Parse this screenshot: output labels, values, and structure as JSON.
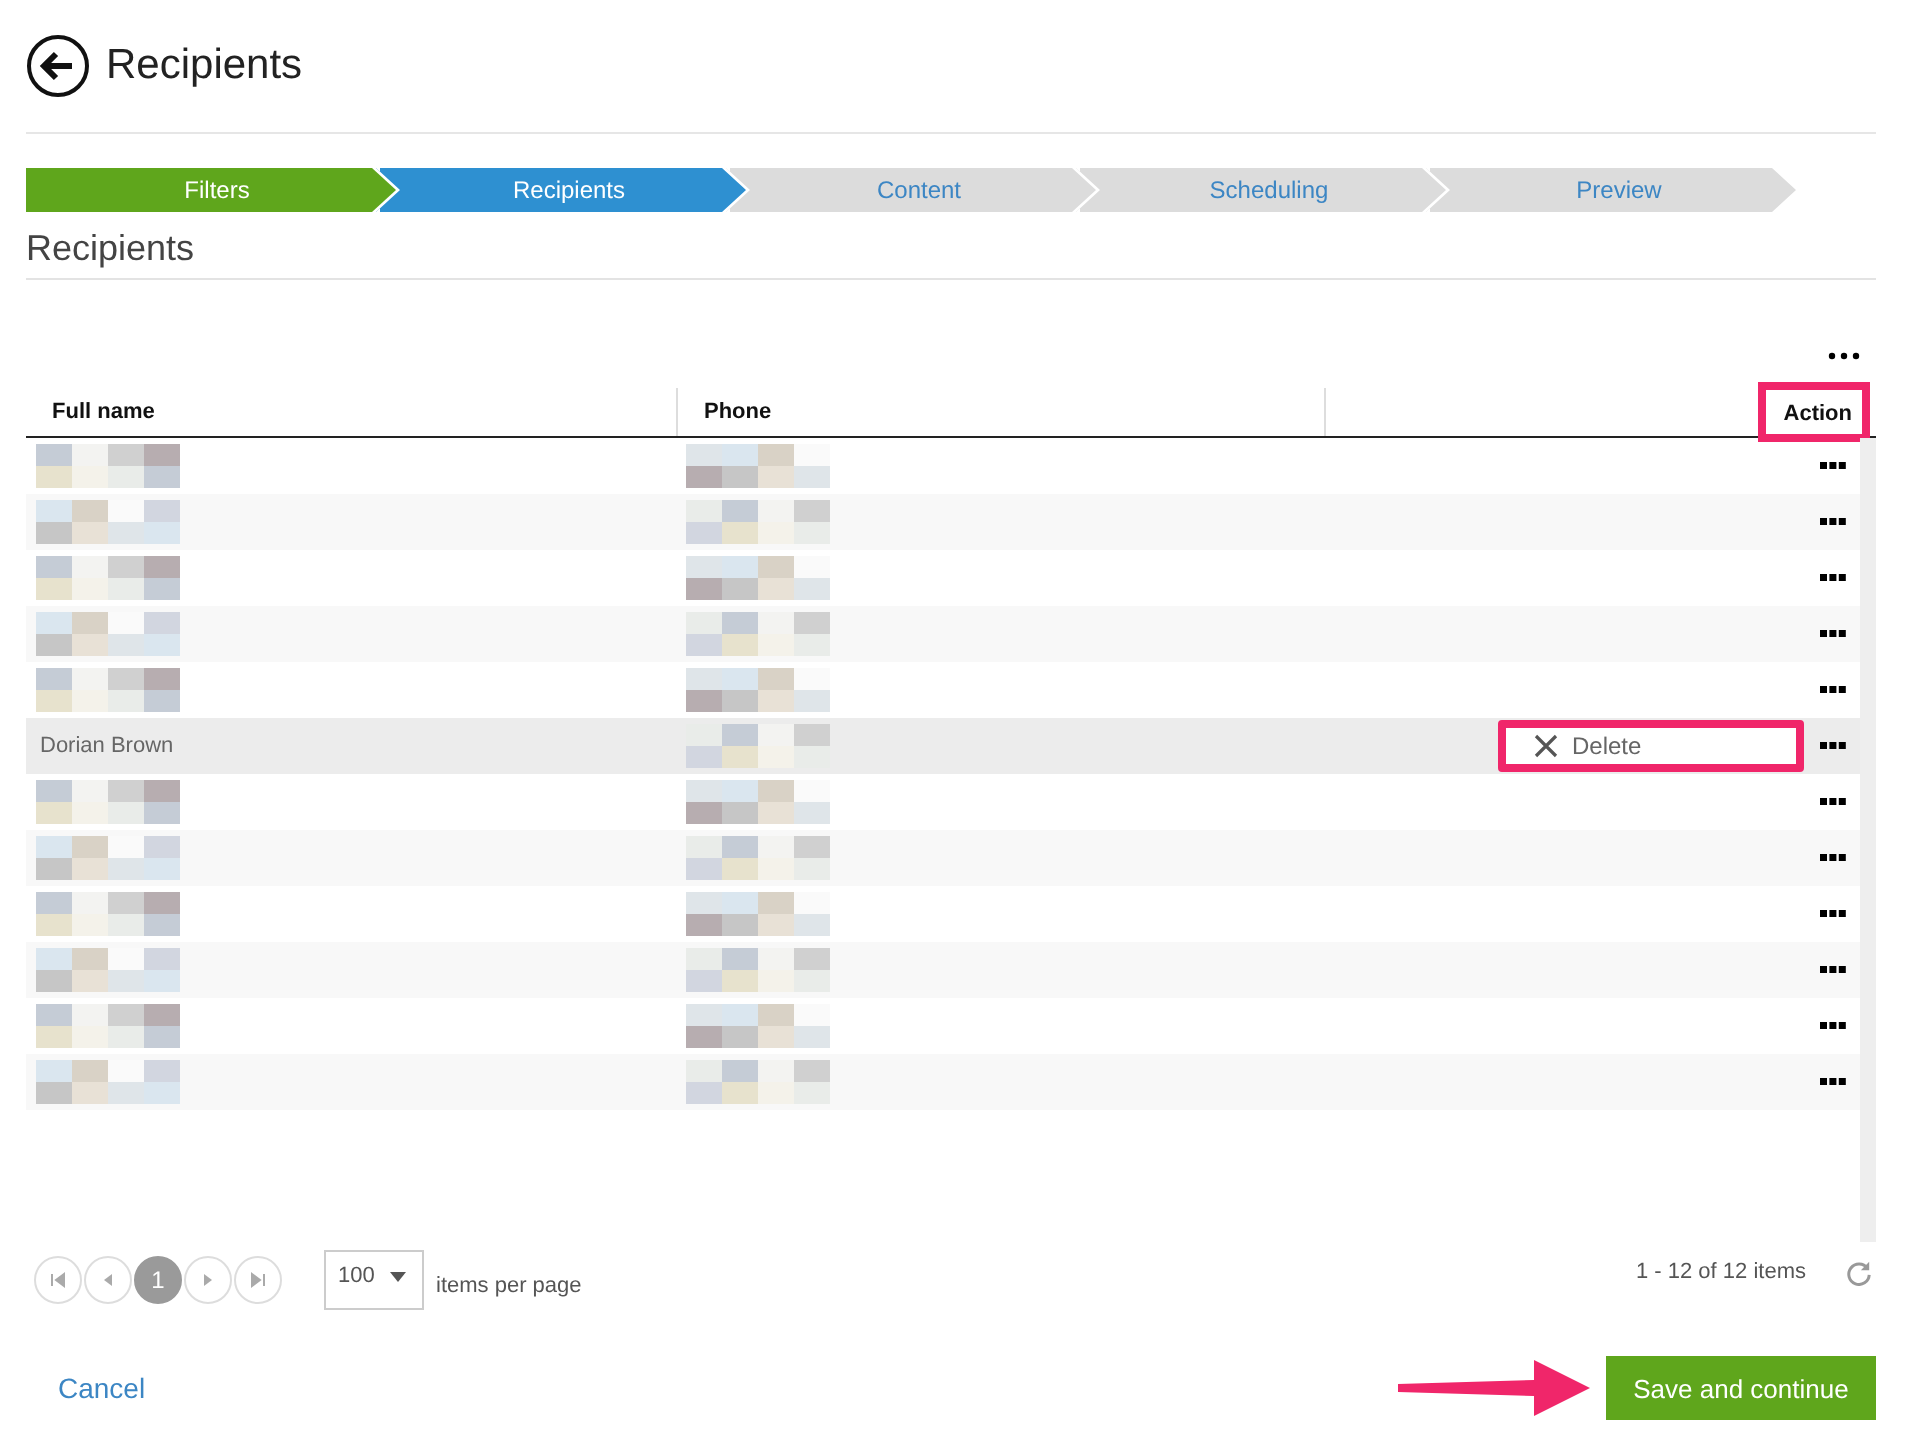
{
  "header": {
    "title": "Recipients"
  },
  "steps": [
    {
      "label": "Filters",
      "completed": true,
      "selected": false
    },
    {
      "label": "Recipients",
      "completed": false,
      "selected": true
    },
    {
      "label": "Content",
      "completed": false,
      "selected": false
    },
    {
      "label": "Scheduling",
      "completed": false,
      "selected": false
    },
    {
      "label": "Preview",
      "completed": false,
      "selected": false
    }
  ],
  "section_title": "Recipients",
  "table": {
    "columns": [
      {
        "label": "Full name",
        "highlighted": false
      },
      {
        "label": "Phone",
        "highlighted": false
      },
      {
        "label": "Action",
        "highlighted": true
      }
    ],
    "rows": [
      {
        "name_redacted": true,
        "phone_redacted": true,
        "hovered": false
      },
      {
        "name_redacted": true,
        "phone_redacted": true,
        "hovered": false
      },
      {
        "name_redacted": true,
        "phone_redacted": true,
        "hovered": false
      },
      {
        "name_redacted": true,
        "phone_redacted": true,
        "hovered": false
      },
      {
        "name_redacted": true,
        "phone_redacted": true,
        "hovered": false
      },
      {
        "full_name": "Dorian Brown",
        "name_redacted": false,
        "phone_redacted": true,
        "hovered": true,
        "menu": {
          "label": "Delete",
          "highlighted": true
        }
      },
      {
        "name_redacted": true,
        "phone_redacted": true,
        "hovered": false
      },
      {
        "name_redacted": true,
        "phone_redacted": true,
        "hovered": false
      },
      {
        "name_redacted": true,
        "phone_redacted": true,
        "hovered": false
      },
      {
        "name_redacted": true,
        "phone_redacted": true,
        "hovered": false
      },
      {
        "name_redacted": true,
        "phone_redacted": true,
        "hovered": false
      },
      {
        "name_redacted": true,
        "phone_redacted": true,
        "hovered": false
      }
    ]
  },
  "pager": {
    "pages": [
      {
        "label": "1",
        "selected": true
      }
    ],
    "page_size": "100",
    "page_size_label": "items per page",
    "summary": "1 - 12 of 12 items"
  },
  "footer": {
    "cancel": "Cancel",
    "save": "Save and continue",
    "save_arrow": true
  }
}
